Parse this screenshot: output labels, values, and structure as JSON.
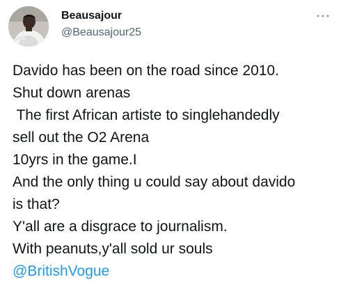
{
  "user": {
    "display_name": "Beausajour",
    "handle": "@Beausajour25",
    "avatar_icon": "avatar-photo"
  },
  "more_icon": "ellipsis-icon",
  "tweet": {
    "lines": [
      "Davido has been on the road since 2010.",
      "Shut down arenas",
      " The first African artiste to singlehandedly",
      "sell out the O2 Arena",
      "10yrs in the game.I",
      "And the only thing u could say about davido",
      "is that?",
      "Y'all are a disgrace to journalism.",
      "With peanuts,y'all sold ur souls"
    ],
    "mention": "@BritishVogue"
  },
  "colors": {
    "text": "#0f1419",
    "secondary": "#536471",
    "link": "#1d9bf0"
  }
}
